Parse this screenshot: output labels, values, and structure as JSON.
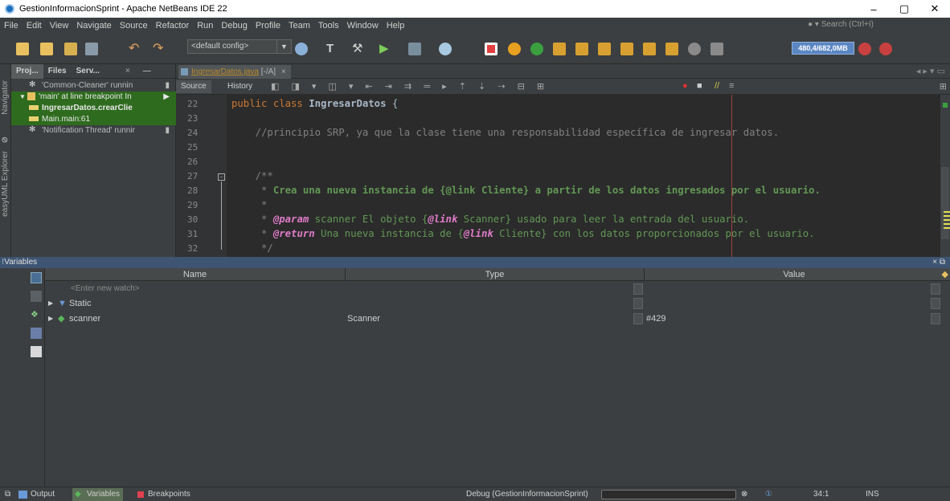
{
  "window": {
    "title": "GestionInformacionSprint - Apache NetBeans IDE 22",
    "minimize": "–",
    "maximize": "▢",
    "close": "✕"
  },
  "menu": [
    "File",
    "Edit",
    "View",
    "Navigate",
    "Source",
    "Refactor",
    "Run",
    "Debug",
    "Profile",
    "Team",
    "Tools",
    "Window",
    "Help"
  ],
  "search_placeholder": "Search (Ctrl+I)",
  "toolbar": {
    "config": "<default config>",
    "memory": "480,4/682,0MB"
  },
  "left_strip": {
    "navigator": "Navigator",
    "easyuml": "easyUML Explorer"
  },
  "debug_panel": {
    "tabs": [
      "Proj...",
      "Files",
      "Serv..."
    ],
    "close": "×",
    "minimize": "—",
    "threads": [
      {
        "label": "'Common-Cleaner' runnin",
        "highlight": false
      },
      {
        "label": "'main' at line breakpoint In",
        "highlight": true
      },
      {
        "label": "IngresarDatos.crearClie",
        "highlight": true
      },
      {
        "label": "Main.main:61",
        "highlight": true
      },
      {
        "label": "'Notification Thread' runnir",
        "highlight": false
      }
    ]
  },
  "editor": {
    "tab_file": "IngresarDatos.java",
    "tab_suffix": "[-/A]",
    "tab_close": "×",
    "source_label": "Source",
    "history_label": "History",
    "line_numbers": [
      "22",
      "23",
      "24",
      "25",
      "26",
      "27",
      "28",
      "29",
      "30",
      "31",
      "32"
    ]
  },
  "code": {
    "l22_kw": "public class ",
    "l22_name": "IngresarDatos",
    "l22_rest": " {",
    "l24": "    //principio SRP, ya que la clase tiene una responsabilidad específica de ingresar datos.",
    "l27": "    /**",
    "l28_a": "     * ",
    "l28_b": "Crea una nueva instancia de {",
    "l28_tag": "@link",
    "l28_c": " Cliente} a partir de los datos ingresados por el usuario.",
    "l29": "     *",
    "l30_a": "     * ",
    "l30_tag": "@param",
    "l30_b": " scanner El objeto {",
    "l30_tag2": "@link",
    "l30_c": " Scanner} usado para leer la entrada del usuario.",
    "l31_a": "     * ",
    "l31_tag": "@return",
    "l31_b": " Una nueva instancia de {",
    "l31_tag2": "@link",
    "l31_c": " Cliente} con los datos proporcionados por el usuario.",
    "l32": "     */"
  },
  "variables": {
    "title": "Variables",
    "close": "×",
    "columns": [
      "Name",
      "Type",
      "Value"
    ],
    "rows": [
      {
        "name": "<Enter new watch>",
        "type": "",
        "value": ""
      },
      {
        "name": "Static",
        "type": "",
        "value": ""
      },
      {
        "name": "scanner",
        "type": "Scanner",
        "value": "#429"
      }
    ]
  },
  "status": {
    "output": "Output",
    "variables": "Variables",
    "breakpoints": "Breakpoints",
    "debug_session": "Debug (GestionInformacionSprint)",
    "position": "34:1",
    "mode": "INS"
  },
  "colors": {
    "background": "#3c3f41",
    "editor_bg": "#2b2b2b",
    "keyword": "#cc7832",
    "comment": "#808080",
    "javadoc": "#629755",
    "thread_highlight": "#2e6b1e",
    "panel_header": "#3d5572"
  }
}
